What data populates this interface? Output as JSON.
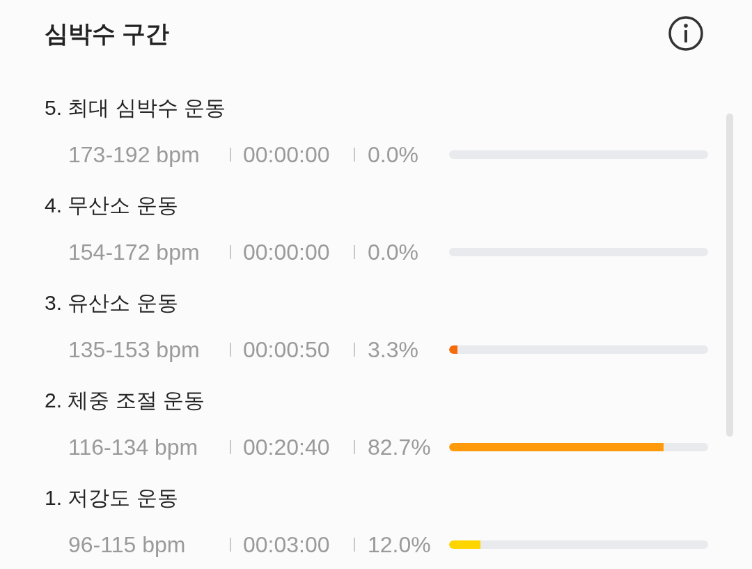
{
  "title": "심박수 구간",
  "zones": [
    {
      "name": "5. 최대 심박수 운동",
      "range": "173-192 bpm",
      "duration": "00:00:00",
      "percent": "0.0%"
    },
    {
      "name": "4. 무산소 운동",
      "range": "154-172 bpm",
      "duration": "00:00:00",
      "percent": "0.0%"
    },
    {
      "name": "3. 유산소 운동",
      "range": "135-153 bpm",
      "duration": "00:00:50",
      "percent": "3.3%",
      "level": 0.033,
      "color": "#f76b0a"
    },
    {
      "name": "2. 체중 조절 운동",
      "range": "116-134 bpm",
      "duration": "00:20:40",
      "percent": "82.7%",
      "level": 0.827,
      "color": "#ff9a0d"
    },
    {
      "name": "1. 저강도 운동",
      "range": "96-115 bpm",
      "duration": "00:03:00",
      "percent": "12.0%",
      "level": 0.12,
      "color": "#ffd500"
    }
  ]
}
